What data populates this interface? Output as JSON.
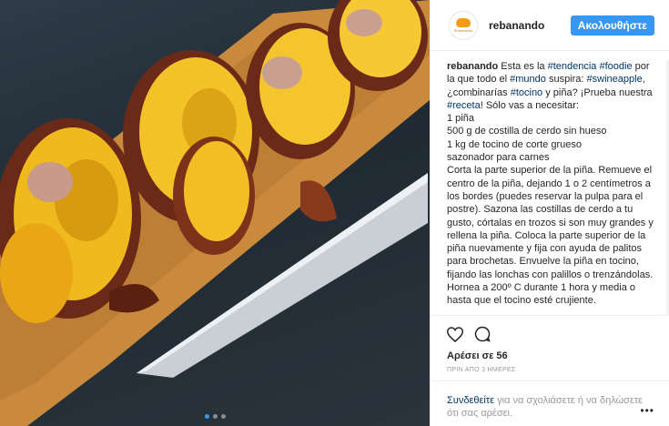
{
  "post": {
    "username": "rebanando",
    "avatar_text": "Rebanando",
    "follow_label": "Ακολουθήστε",
    "caption": {
      "author": "rebanando",
      "parts": [
        {
          "t": "Esta es la "
        },
        {
          "t": "#tendencia",
          "tag": true
        },
        {
          "t": " "
        },
        {
          "t": "#foodie",
          "tag": true
        },
        {
          "t": " por la que todo el "
        },
        {
          "t": "#mundo",
          "tag": true
        },
        {
          "t": " suspira: "
        },
        {
          "t": "#swineapple",
          "tag": true
        },
        {
          "t": ", ¿combinarías "
        },
        {
          "t": "#tocino",
          "tag": true
        },
        {
          "t": " y piña? ¡Prueba nuestra "
        },
        {
          "t": "#receta",
          "tag": true
        },
        {
          "t": "! Sólo vas a necesitar:"
        }
      ],
      "lines": [
        "1 piña",
        "500 g de costilla de cerdo sin hueso",
        "1 kg de tocino de corte grueso",
        "sazonador para carnes",
        "Corta la parte superior de la piña. Remueve el centro de la piña, dejando 1 o 2 centímetros a los bordes (puedes reservar la pulpa para el postre). Sazona las costillas de cerdo a tu gusto, córtalas en trozos si son muy grandes y rellena la piña. Coloca la parte superior de la piña nuevamente y fija con ayuda de palitos para brochetas. Envuelve la piña en tocino, fijando las lonchas con palillos o trenzándolas. Hornea a 200º C durante 1 hora y media o hasta que el tocino esté crujiente."
      ]
    },
    "likes": "Αρέσει σε 56",
    "time": "ΠΡΙΝ ΑΠΟ 3 ΗΜΕΡΕΣ",
    "comment": {
      "login": "Συνδεθείτε",
      "rest": " για να σχολιάσετε ή να δηλώσετε ότι σας αρέσει."
    },
    "more_label": "•••",
    "carousel": {
      "count": 3,
      "active": 0
    }
  },
  "colors": {
    "accent": "#3897f0",
    "hashtag": "#003569",
    "muted": "#999999"
  },
  "icons": [
    "heart-outline-icon",
    "comment-bubble-icon",
    "more-options-icon"
  ]
}
